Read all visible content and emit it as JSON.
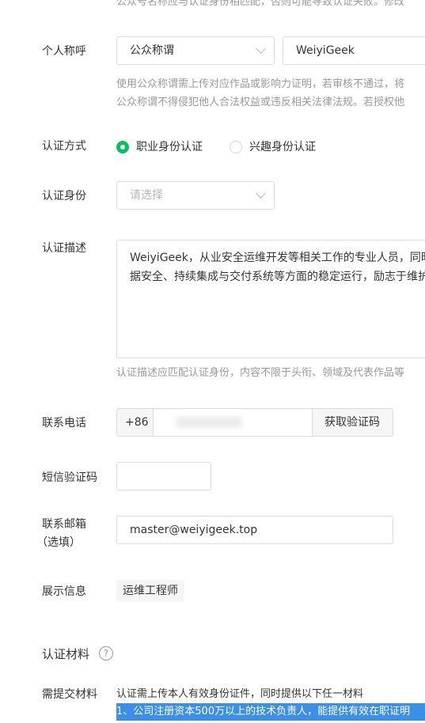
{
  "top_hint": "公众号名称应与认证身份相匹配，否则可能导致认证失败。修改",
  "personal_title": {
    "label": "个人称呼",
    "select_value": "公众称谓",
    "input_value": "WeiyiGeek",
    "hint_line1": "使用公众称谓需上传对应作品或影响力证明，若审核不通过，将",
    "hint_line2": "公众称谓不得侵犯他人合法权益或违反相关法律法规。若授权他"
  },
  "auth_method": {
    "label": "认证方式",
    "options": [
      {
        "label": "职业身份认证",
        "selected": true
      },
      {
        "label": "兴趣身份认证",
        "selected": false
      }
    ]
  },
  "auth_identity": {
    "label": "认证身份",
    "placeholder": "请选择"
  },
  "auth_desc": {
    "label": "认证描述",
    "line1": "WeiyiGeek，从业安全运维开发等相关工作的专业人员，同时",
    "line2": "据安全、持续集成与交付系统等方面的稳定运行，励志于维护",
    "hint": "认证描述应匹配认证身份，内容不限于头衔、领域及代表作品等"
  },
  "phone": {
    "label": "联系电话",
    "prefix": "+86",
    "button": "获取验证码"
  },
  "sms_code": {
    "label": "短信验证码",
    "value": ""
  },
  "email": {
    "label_line1": "联系邮箱",
    "label_line2": "（选填）",
    "value": "master@weiyigeek.top"
  },
  "display_info": {
    "label": "展示信息",
    "tag": "运维工程师"
  },
  "materials": {
    "section_title": "认证材料",
    "help_glyph": "?",
    "label": "需提交材料",
    "line1": "认证需上传本人有效身份证件，同时提供以下任一材料",
    "line2": "1、公司注册资本500万以上的技术负责人，能提供有效在职证明"
  },
  "colors": {
    "accent": "#07c160",
    "selection": "#3b8fe6"
  },
  "icons": {
    "chevron": "chevron-down-icon",
    "help": "help-circle-icon",
    "radio_on": "radio-checked-icon",
    "radio_off": "radio-unchecked-icon"
  }
}
